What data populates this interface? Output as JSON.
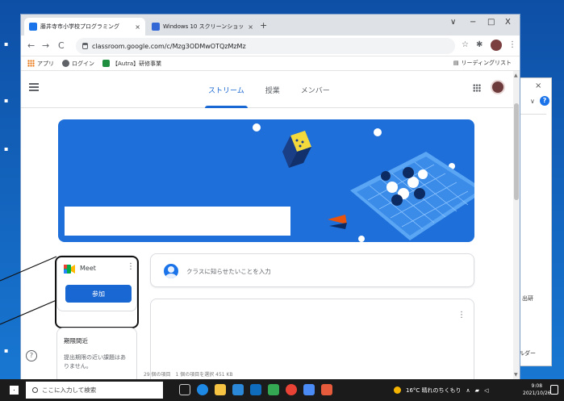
{
  "browser": {
    "tabs": [
      {
        "title": "藤井寺市小学校プログラミング",
        "favicon_color": "#1a73e8",
        "active": true
      },
      {
        "title": "Windows 10 スクリーンショットを撮る",
        "favicon_color": "#3367d6",
        "active": false
      }
    ],
    "url": "classroom.google.com/c/Mzg3ODMwOTQzMzMz",
    "bookmarks": [
      {
        "label": "アプリ",
        "icon": "apps-grid-icon",
        "color": "#e8710a"
      },
      {
        "label": "ログイン",
        "icon": "globe-icon",
        "color": "#5f6368"
      },
      {
        "label": "【Autra】研修事業",
        "icon": "bookmark-icon",
        "color": "#1e8e3e"
      }
    ],
    "reading_list": "リーディングリスト",
    "window_controls": {
      "minimize": "−",
      "maximize": "□",
      "close": "X",
      "dropdown": "∨"
    }
  },
  "classroom": {
    "nav_tabs": [
      {
        "label": "ストリーム",
        "selected": true
      },
      {
        "label": "授業",
        "selected": false
      },
      {
        "label": "メンバー",
        "selected": false
      }
    ],
    "accent_color": "#1967d2",
    "banner_color": "#1e6fd9",
    "meet": {
      "label": "Meet",
      "join_button": "参加"
    },
    "upcoming": {
      "title": "期限間近",
      "text": "提出期限の近い課題はありません。"
    },
    "announce_prompt": "クラスに知らせたいことを入力",
    "status_line": "29 個の項目　1 個の項目を選択 451 KB"
  },
  "background_window": {
    "text1": "出研",
    "text2": "ルダー"
  },
  "taskbar": {
    "search_placeholder": "ここに入力して検索",
    "weather": "16°C 晴れのちくもり",
    "time": "9:08",
    "date": "2021/10/26"
  }
}
